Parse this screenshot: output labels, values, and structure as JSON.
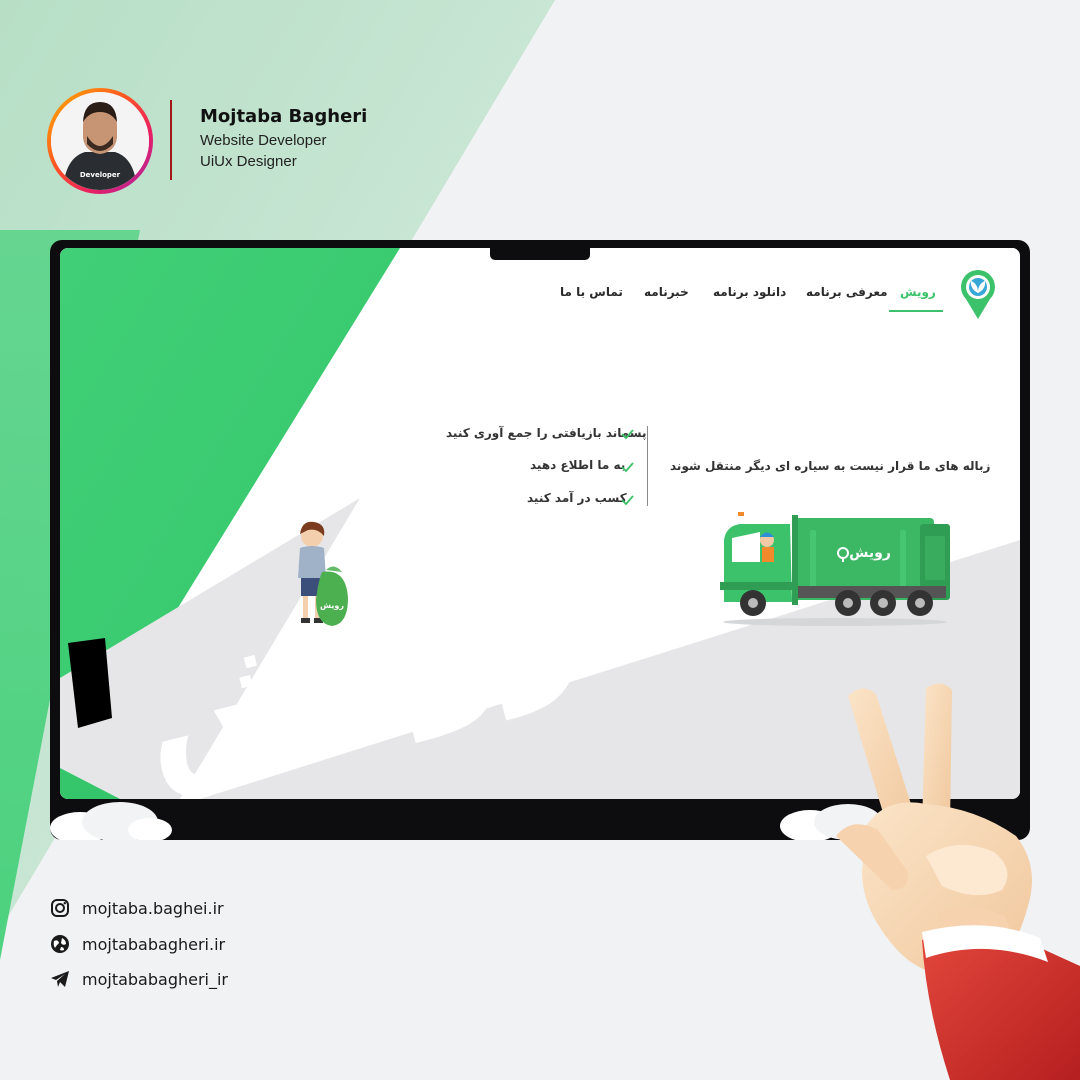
{
  "profile": {
    "name": "Mojtaba Bagheri",
    "role_1": "Website Developer",
    "role_2": "UiUx Designer",
    "hoodie_text": "Developer"
  },
  "website": {
    "brand_color": "#3cc26a",
    "nav": {
      "items": [
        {
          "label": "رویش",
          "active": true
        },
        {
          "label": "معرفی برنامه",
          "active": false
        },
        {
          "label": "دانلود برنامه",
          "active": false
        },
        {
          "label": "خبرنامه",
          "active": false
        },
        {
          "label": "تماس با ما",
          "active": false
        }
      ]
    },
    "hero": {
      "tagline": "زباله های ما قرار نیست به سیاره ای دیگر  منتقل شوند",
      "checklist": [
        "پسماند بازیافتی را جمع آوری کنید",
        "به ما اطلاع دهید",
        "کسب در آمد کنید"
      ],
      "truck_label": "رویش",
      "bag_label": "رویش",
      "big_watermark": "رویش"
    }
  },
  "contacts": [
    {
      "icon": "instagram-icon",
      "text": "mojtaba.baghei.ir"
    },
    {
      "icon": "globe-icon",
      "text": "mojtababagheri.ir"
    },
    {
      "icon": "telegram-icon",
      "text": "mojtababagheri_ir"
    }
  ]
}
